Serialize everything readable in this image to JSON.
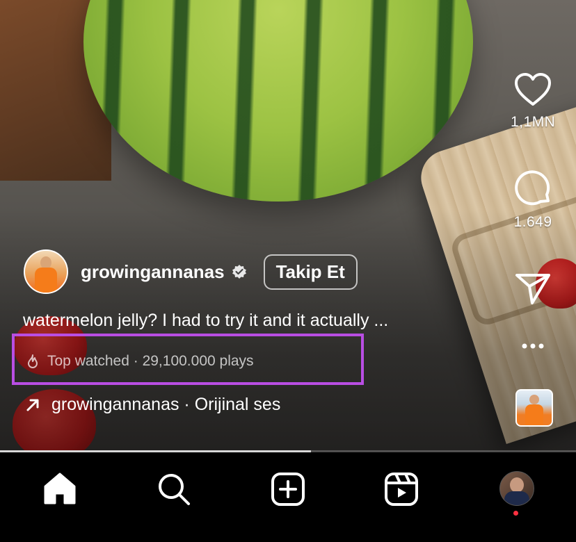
{
  "reel": {
    "likes": "1,1MN",
    "comments": "1.649",
    "author": {
      "username": "growingannanas",
      "follow_label": "Takip Et"
    },
    "caption": "watermelon jelly? I had to try it and it actually ...",
    "stats": "Top watched · 29,100.000 plays",
    "audio": "growingannanas · Orijinal ses",
    "progress": 0.54
  },
  "colors": {
    "highlight": "#b94ee3",
    "notification_dot": "#ff3040"
  },
  "icons": [
    "heart-icon",
    "comment-icon",
    "share-icon",
    "more-icon",
    "audio-thumb",
    "home-icon",
    "search-icon",
    "create-icon",
    "reels-icon",
    "profile-avatar"
  ]
}
